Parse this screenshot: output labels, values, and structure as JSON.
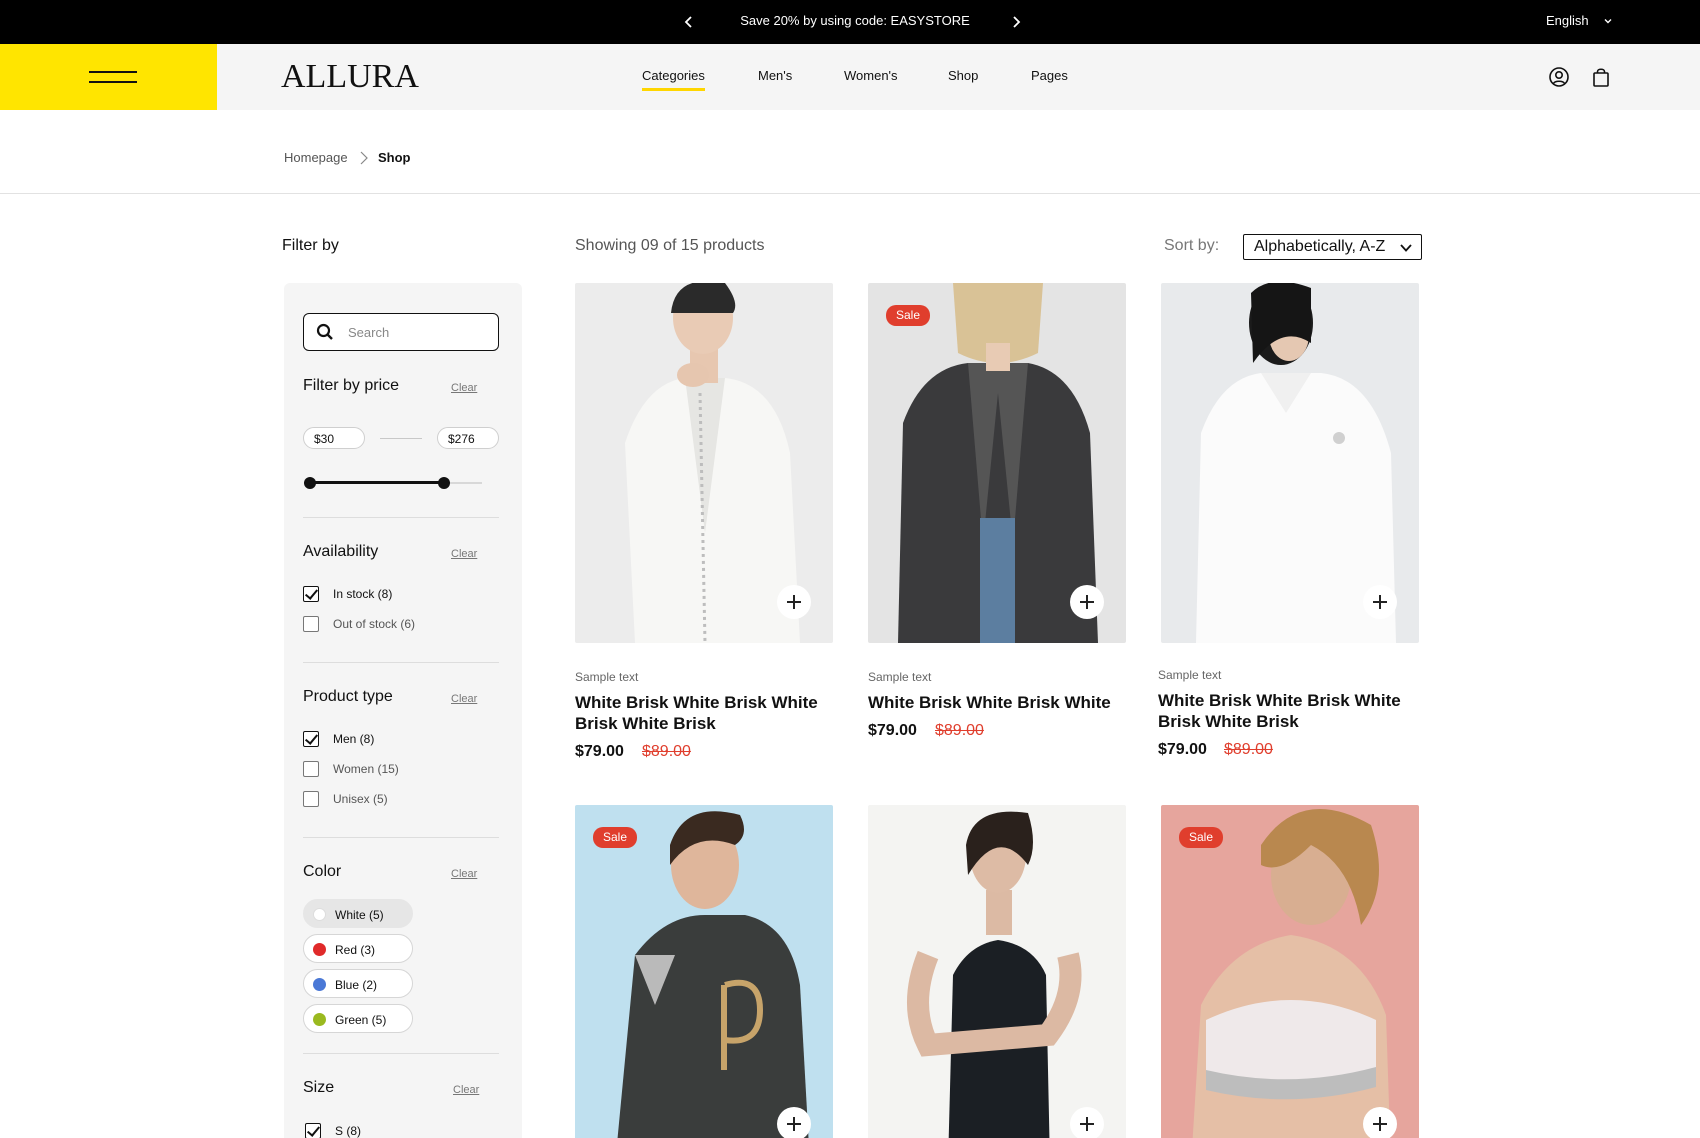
{
  "announcement": {
    "text": "Save 20% by using code: EASYSTORE",
    "language": "English"
  },
  "header": {
    "logo": "ALLURA",
    "nav": [
      "Categories",
      "Men's",
      "Women's",
      "Shop",
      "Pages"
    ],
    "active_nav": "Categories",
    "accent_color": "#ffe500"
  },
  "breadcrumb": {
    "home": "Homepage",
    "current": "Shop"
  },
  "filters": {
    "title": "Filter by",
    "search_placeholder": "Search",
    "clear_label": "Clear",
    "price": {
      "title": "Filter by price",
      "min": "$30",
      "max": "$276",
      "range_low_fraction": 0.0,
      "range_high_fraction": 0.78
    },
    "availability": {
      "title": "Availability",
      "options": [
        {
          "label": "In stock (8)",
          "checked": true
        },
        {
          "label": "Out of stock (6)",
          "checked": false
        }
      ]
    },
    "product_type": {
      "title": "Product type",
      "options": [
        {
          "label": "Men (8)",
          "checked": true
        },
        {
          "label": "Women (15)",
          "checked": false
        },
        {
          "label": "Unisex (5)",
          "checked": false
        }
      ]
    },
    "color": {
      "title": "Color",
      "options": [
        {
          "label": "White (5)",
          "swatch": "#ffffff",
          "selected": true
        },
        {
          "label": "Red (3)",
          "swatch": "#e02a2a",
          "selected": false
        },
        {
          "label": "Blue (2)",
          "swatch": "#4a78d6",
          "selected": false
        },
        {
          "label": "Green (5)",
          "swatch": "#9ab91f",
          "selected": false
        }
      ]
    },
    "size": {
      "title": "Size",
      "options": [
        {
          "label": "S (8)",
          "checked": true
        }
      ]
    }
  },
  "listing": {
    "showing": "Showing 09 of 15 products",
    "sort_label": "Sort by:",
    "sort_value": "Alphabetically, A-Z",
    "sale_label": "Sale"
  },
  "products": [
    {
      "subtitle": "Sample text",
      "title": "White Brisk White Brisk White Brisk White Brisk",
      "price": "$79.00",
      "old_price": "$89.00",
      "sale": false
    },
    {
      "subtitle": "Sample text",
      "title": "White Brisk White Brisk White",
      "price": "$79.00",
      "old_price": "$89.00",
      "sale": true
    },
    {
      "subtitle": "Sample text",
      "title": "White Brisk White Brisk White Brisk White Brisk",
      "price": "$79.00",
      "old_price": "$89.00",
      "sale": false
    },
    {
      "sale": true
    },
    {
      "sale": false
    },
    {
      "sale": true
    }
  ]
}
